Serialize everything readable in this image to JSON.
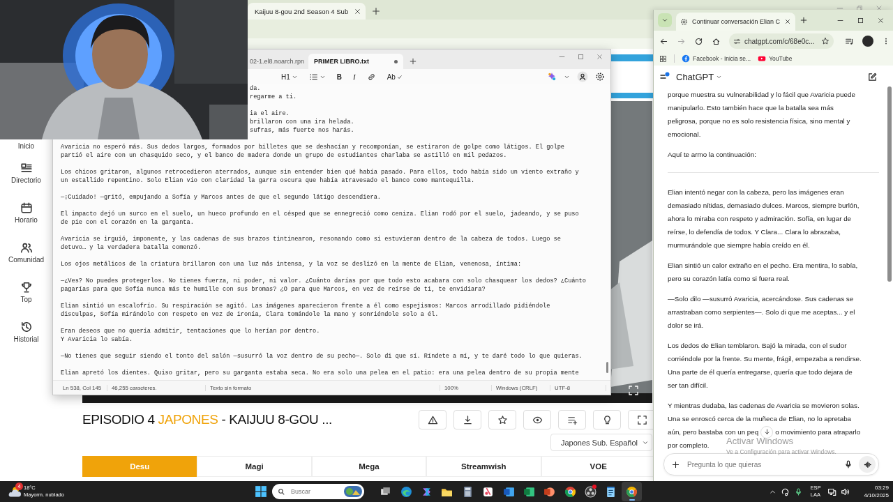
{
  "background_browser": {
    "tab": {
      "title": "Kaijuu 8-gou 2nd Season 4 Sub"
    },
    "site_nav": [
      {
        "label": "Inicio"
      },
      {
        "label": "Directorio",
        "kind": "directory"
      },
      {
        "label": "Horario",
        "kind": "schedule"
      },
      {
        "label": "Comunidad",
        "kind": "community"
      },
      {
        "label": "Top",
        "kind": "top"
      },
      {
        "label": "Historial",
        "kind": "history"
      }
    ],
    "episode_title": [
      {
        "text": "EPISODIO 4",
        "accent": false
      },
      {
        "text": "JAPONES",
        "accent": true
      },
      {
        "text": "- KAIJUU 8-GOU ...",
        "accent": false
      }
    ],
    "actions": [
      {
        "kind": "report"
      },
      {
        "kind": "download"
      },
      {
        "kind": "favorite"
      },
      {
        "kind": "watch"
      },
      {
        "kind": "playlist"
      },
      {
        "kind": "light"
      },
      {
        "kind": "fullscreen"
      }
    ],
    "language_select": {
      "value": "Japones Sub. Español"
    },
    "servers": [
      {
        "label": "Desu",
        "selected": true
      },
      {
        "label": "Magi",
        "selected": false
      },
      {
        "label": "Mega",
        "selected": false
      },
      {
        "label": "Streamwish",
        "selected": false
      },
      {
        "label": "VOE",
        "selected": false
      }
    ]
  },
  "notepad": {
    "tabs": [
      {
        "title": "02-1.el8.noarch.rpn",
        "selected": false,
        "unsaved": false
      },
      {
        "title": "PRIMER LIBRO.txt",
        "selected": true,
        "unsaved": true
      }
    ],
    "toolbar": [
      {
        "kind": "heading",
        "label": "H1"
      },
      {
        "kind": "list"
      },
      {
        "kind": "bold",
        "label": "B"
      },
      {
        "kind": "italic",
        "label": "I"
      },
      {
        "kind": "link"
      },
      {
        "kind": "spelling",
        "label": "Ab"
      }
    ],
    "fragments": [
      [
        "da.",
        "regarme a ti."
      ],
      [
        "ia el aire.",
        "brillaron con una ira helada.",
        "sufras, más fuerte nos harás."
      ]
    ],
    "paragraphs": [
      [
        "Avaricia no esperó más. Sus dedos largos, formados por billetes que se deshacían y recomponían, se estiraron de golpe como látigos. El golpe",
        "partió el aire con un chasquido seco, y el banco de madera donde un grupo de estudiantes charlaba se astilló en mil pedazos."
      ],
      [
        "Los chicos gritaron, algunos retrocedieron aterrados, aunque sin entender bien qué había pasado. Para ellos, todo había sido un viento extraño y",
        "un estallido repentino. Solo Elian vio con claridad la garra oscura que había atravesado el banco como mantequilla."
      ],
      [
        "—¡Cuidado! —gritó, empujando a Sofía y Marcos antes de que el segundo látigo descendiera."
      ],
      [
        "El impacto dejó un surco en el suelo, un hueco profundo en el césped que se ennegreció como ceniza. Elian rodó por el suelo, jadeando, y se puso",
        "de pie con el corazón en la garganta."
      ],
      [
        "Avaricia se irguió, imponente, y las cadenas de sus brazos tintinearon, resonando como si estuvieran dentro de la cabeza de todos. Luego se",
        "detuvo… y la verdadera batalla comenzó."
      ],
      [
        "Los ojos metálicos de la criatura brillaron con una luz más intensa, y la voz se deslizó en la mente de Elian, venenosa, íntima:"
      ],
      [
        "—¿Ves? No puedes protegerlos. No tienes fuerza, ni poder, ni valor. ¿Cuánto darías por que todo esto acabara con solo chasquear los dedos? ¿Cuánto",
        "pagarías para que Sofía nunca más te humille con sus bromas? ¿O para que Marcos, en vez de reírse de ti, te envidiara?"
      ],
      [
        "Elian sintió un escalofrío. Su respiración se agitó. Las imágenes aparecieron frente a él como espejismos: Marcos arrodillado pidiéndole",
        "disculpas, Sofía mirándolo con respeto en vez de ironía, Clara tomándole la mano y sonriéndole solo a él."
      ],
      [
        "Eran deseos que no quería admitir, tentaciones que lo herían por dentro.",
        "Y Avaricia lo sabía."
      ],
      [
        "—No tienes que seguir siendo el tonto del salón —susurró la voz dentro de su pecho—. Solo di que sí. Ríndete a mí, y te daré todo lo que quieras."
      ],
      [
        "Elian apretó los dientes. Quiso gritar, pero su garganta estaba seca. No era solo una pelea en el patio: era una pelea dentro de su propia mente"
      ]
    ],
    "status": [
      "Ln 538, Col 145",
      "46,255 caracteres.",
      "Texto sin formato",
      "100%",
      "Windows (CRLF)",
      "UTF-8"
    ]
  },
  "chat_browser": {
    "tab": {
      "title": "Continuar conversación Elian C"
    },
    "url": "chatgpt.com/c/68e0c...",
    "bookmarks": [
      {
        "kind": "facebook",
        "label": "Facebook - Inicia se..."
      },
      {
        "kind": "youtube",
        "label": "YouTube"
      }
    ],
    "app_title": "ChatGPT",
    "messages": [
      {
        "kind": "paragraph",
        "lines": [
          "porque muestra su vulnerabilidad y lo fácil que Avaricia puede",
          "manipularlo. Esto también hace que la batalla sea más",
          "peligrosa, porque no es solo resistencia física, sino mental y",
          "emocional."
        ]
      },
      {
        "kind": "paragraph",
        "lines": [
          "Aquí te armo la continuación:"
        ]
      },
      {
        "kind": "rule"
      },
      {
        "kind": "paragraph",
        "lines": [
          "Elian intentó negar con la cabeza, pero las imágenes eran",
          "demasiado nítidas, demasiado dulces. Marcos, siempre burlón,",
          "ahora lo miraba con respeto y admiración. Sofía, en lugar de",
          "reírse, lo defendía de todos. Y Clara... Clara lo abrazaba,",
          "murmurándole que siempre había creído en él."
        ]
      },
      {
        "kind": "paragraph",
        "lines": [
          "Elian sintió un calor extraño en el pecho. Era mentira, lo sabía,",
          "pero su corazón latía como si fuera real."
        ]
      },
      {
        "kind": "paragraph",
        "lines": [
          "—Solo dilo —susurró Avaricia, acercándose. Sus cadenas se",
          "arrastraban como serpientes—. Solo di que me aceptas... y el",
          "dolor se irá."
        ]
      },
      {
        "kind": "paragraph",
        "lines": [
          "Los dedos de Elian temblaron. Bajó la mirada, con el sudor",
          "corriéndole por la frente. Su mente, frágil, empezaba a rendirse.",
          "Una parte de él quería entregarse, quería que todo dejara de",
          "ser tan difícil."
        ]
      },
      {
        "kind": "paragraph",
        "lines": [
          "Y mientras dudaba, las cadenas de Avaricia se movieron solas.",
          "Una se enroscó cerca de la muñeca de Elian, no lo apretaba"
        ]
      },
      {
        "kind": "split_line",
        "before": "aún, pero bastaba con un peq",
        "after": "o movimiento para atraparlo"
      },
      {
        "kind": "paragraph",
        "continued": true,
        "lines": [
          "por completo."
        ]
      }
    ],
    "input": {
      "placeholder": "Pregunta lo que quieras"
    }
  },
  "activation_notice": {
    "title": "Activar Windows",
    "detail": "Ve a Configuración para activar Windows."
  },
  "taskbar": {
    "weather": {
      "badge": "4",
      "temperature": "18°C",
      "condition": "Mayorm. nublado"
    },
    "search_placeholder": "Buscar",
    "apps": [
      {
        "kind": "task-view",
        "active": false,
        "notification": false
      },
      {
        "kind": "wave-browser",
        "active": false,
        "notification": false
      },
      {
        "kind": "assistant",
        "active": false,
        "notification": false
      },
      {
        "kind": "folder",
        "active": false,
        "notification": false
      },
      {
        "kind": "calculator",
        "active": false,
        "notification": false
      },
      {
        "kind": "snipping",
        "active": false,
        "notification": false
      },
      {
        "kind": "document",
        "active": false,
        "notification": false
      },
      {
        "kind": "spreadsheet",
        "active": false,
        "notification": false
      },
      {
        "kind": "presentation",
        "active": false,
        "notification": false
      },
      {
        "kind": "circle-browser",
        "active": false,
        "notification": false
      },
      {
        "kind": "recorder",
        "active": false,
        "notification": true
      },
      {
        "kind": "notepad",
        "active": false,
        "notification": false
      },
      {
        "kind": "circle-browser-alt",
        "active": true,
        "notification": false
      }
    ],
    "language": [
      "ESP",
      "LAA"
    ],
    "time": "03:29",
    "date": "4/10/2025"
  }
}
